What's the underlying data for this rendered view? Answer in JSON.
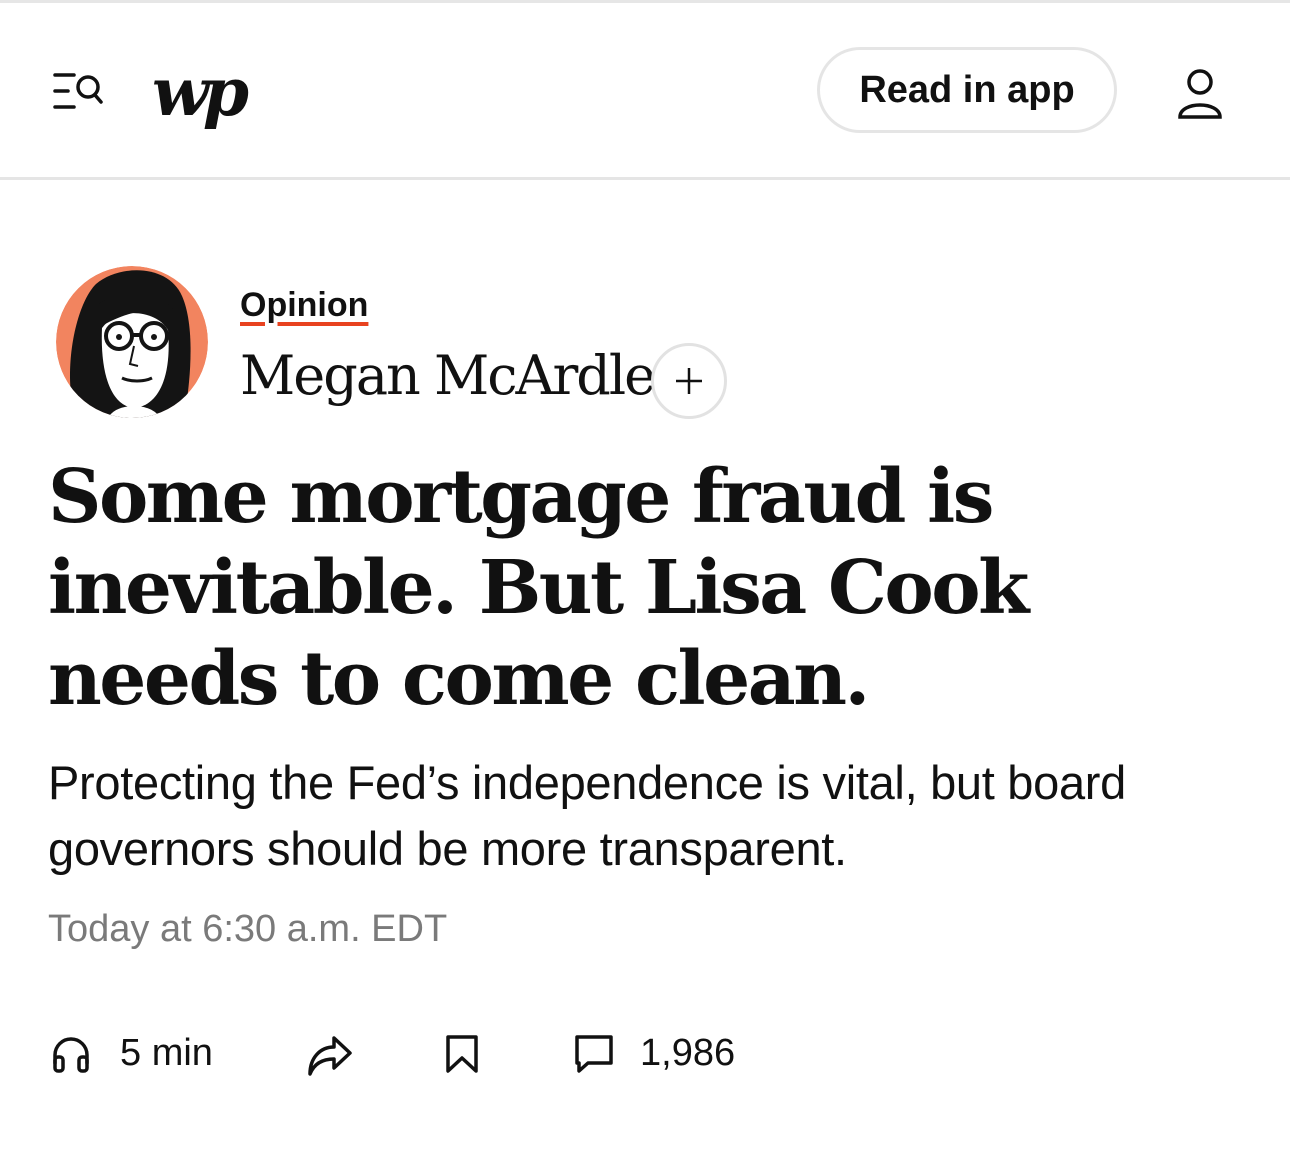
{
  "header": {
    "logo_text": "wp",
    "read_in_app_label": "Read in app"
  },
  "article": {
    "section_label": "Opinion",
    "author_name": "Megan McArdle",
    "follow_symbol": "+",
    "headline": "Some mortgage fraud is inevitable. But Lisa Cook needs to come clean.",
    "dek": "Protecting the Fed’s independence is vital, but board governors should be more transparent.",
    "timestamp": "Today at 6:30 a.m. EDT"
  },
  "actions": {
    "listen_label": "5 min",
    "comments_count": "1,986"
  },
  "colors": {
    "accent_underline": "#e8421f",
    "avatar_background": "#f2845f",
    "timestamp_gray": "#7a7a7a"
  },
  "icons": [
    "menu-search-icon",
    "user-icon",
    "plus-icon",
    "headphones-icon",
    "share-icon",
    "bookmark-icon",
    "comment-icon"
  ]
}
